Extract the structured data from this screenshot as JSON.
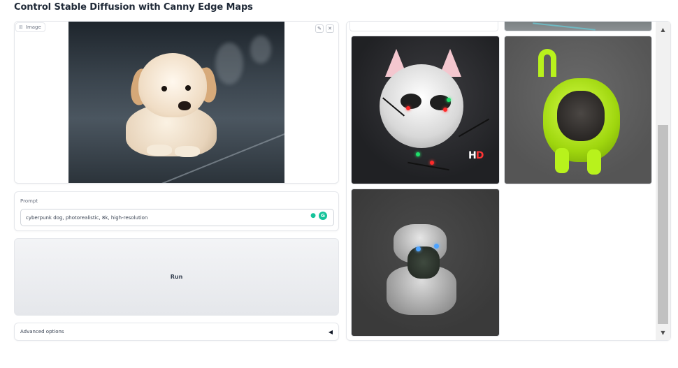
{
  "page": {
    "title": "Control Stable Diffusion with Canny Edge Maps"
  },
  "image_input": {
    "label": "Image",
    "label_icon": "image-icon",
    "edit_icon": "pencil-icon",
    "clear_icon": "close-icon",
    "edit_glyph": "✎",
    "clear_glyph": "✕"
  },
  "prompt": {
    "label": "Prompt",
    "value": "cyberpunk dog, photorealistic, 8k, high-resolution",
    "icons": [
      "bulb-icon",
      "grammarly-icon"
    ]
  },
  "run": {
    "label": "Run"
  },
  "advanced": {
    "label": "Advanced options",
    "caret": "◀"
  },
  "gallery": {
    "items": [
      "partial-image-top-left",
      "partial-image-top-right",
      "husky-robot",
      "green-suit-pug",
      "robot-dog"
    ],
    "hd_logo_white": "H",
    "hd_logo_red": "D"
  },
  "scrollbar": {
    "up": "▲",
    "down": "▼"
  },
  "colors": {
    "accent_green": "#15c39a",
    "panel_border": "#e5e7eb",
    "button_bg": "#e5e7eb"
  }
}
